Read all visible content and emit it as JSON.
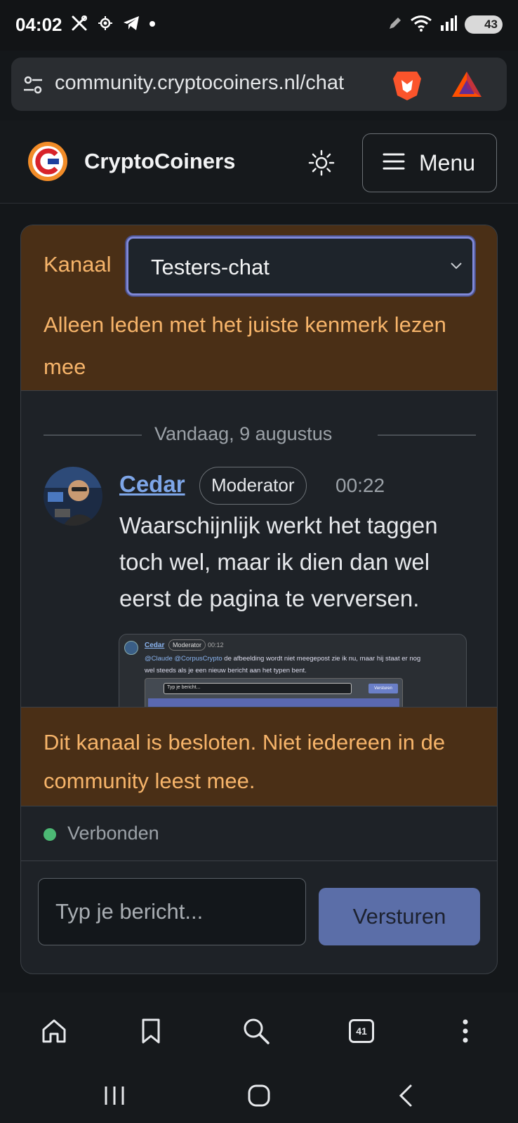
{
  "status_bar": {
    "time": "04:02",
    "battery": "43",
    "icons": [
      "tools-icon",
      "location-icon",
      "telegram-icon",
      "dot-icon",
      "pen-icon",
      "wifi-icon",
      "signal-icon",
      "battery-icon"
    ]
  },
  "browser": {
    "url": "community.cryptocoiners.nl/chat",
    "icons": [
      "site-settings-icon",
      "brave-shields-icon",
      "brave-rewards-icon"
    ]
  },
  "site": {
    "brand": "CryptoCoiners",
    "menu_label": "Menu",
    "icons": [
      "logo-icon",
      "sun-icon",
      "hamburger-icon"
    ]
  },
  "chat": {
    "channel_label": "Kanaal",
    "channel_value": "Testers-chat",
    "members_note": "Alleen leden met het juiste kenmerk lezen mee",
    "day_divider": "Vandaag, 9 augustus",
    "message": {
      "author": "Cedar",
      "role": "Moderator",
      "time": "00:22",
      "text": "Waarschijnlijk werkt het taggen toch wel, maar ik dien dan wel eerst de pagina te verversen."
    },
    "attachment": {
      "author": "Cedar",
      "role": "Moderator",
      "time": "00:12",
      "mention_1": "@Claude",
      "mention_2": "@CorpusCrypto",
      "text": "de afbeelding wordt niet meegepost zie ik nu, maar hij staat er nog wel steeds als je een nieuw bericht aan het typen bent.",
      "input_placeholder": "Typ je bericht...",
      "send_label": "Versturen"
    },
    "closed_notice": "Dit kanaal is besloten. Niet iedereen in de community leest mee.",
    "connection_status": "Verbonden",
    "input_placeholder": "Typ je bericht...",
    "send_label": "Versturen"
  },
  "browser_nav": {
    "tabs_count": "41",
    "icons": [
      "home-icon",
      "bookmark-icon",
      "search-icon",
      "tabs-icon",
      "more-icon"
    ]
  },
  "system_nav": {
    "icons": [
      "recents-icon",
      "home-circle-icon",
      "back-icon"
    ]
  },
  "colors": {
    "background": "#14171a",
    "notice_bg": "#4a2f16",
    "notice_text": "#f6b46a",
    "link": "#7ea6e8",
    "send_button": "#5b6ea8",
    "online": "#4cb874",
    "select_focus": "#7f88d8"
  }
}
